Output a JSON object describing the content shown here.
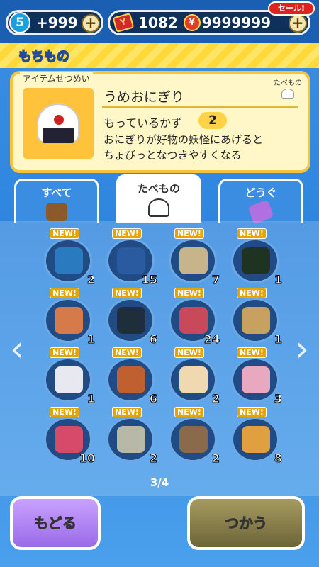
{
  "topbar": {
    "stamina_level": "5",
    "stamina_value": "+999",
    "plus_label": "+",
    "tickets": "1082",
    "money": "9999999",
    "sale_label": "セール!"
  },
  "section_title": "もちもの",
  "item_info": {
    "label": "アイテムせつめい",
    "name": "うめおにぎり",
    "category_tag": "たべもの",
    "count_label": "もっているかず",
    "count_value": "2",
    "description_line1": "おにぎりが好物の妖怪にあげると",
    "description_line2": "ちょびっとなつきやすくなる"
  },
  "tabs": [
    {
      "label": "すべて",
      "selected": false
    },
    {
      "label": "たべもの",
      "selected": true
    },
    {
      "label": "どうぐ",
      "selected": false
    }
  ],
  "grid": {
    "new_label": "NEW!",
    "items": [
      {
        "qty": "2",
        "color": "#2a7abf"
      },
      {
        "qty": "15",
        "color": "#2a5aa0"
      },
      {
        "qty": "7",
        "color": "#c8b48a"
      },
      {
        "qty": "1",
        "color": "#1e3322"
      },
      {
        "qty": "1",
        "color": "#d77a4a"
      },
      {
        "qty": "6",
        "color": "#1e2e3a"
      },
      {
        "qty": "24",
        "color": "#c84a5a"
      },
      {
        "qty": "1",
        "color": "#c8a060"
      },
      {
        "qty": "1",
        "color": "#e8e8f0"
      },
      {
        "qty": "6",
        "color": "#c06030"
      },
      {
        "qty": "2",
        "color": "#f0d8b0"
      },
      {
        "qty": "3",
        "color": "#e8a8c0"
      },
      {
        "qty": "10",
        "color": "#d84a6a"
      },
      {
        "qty": "2",
        "color": "#b8b8a8"
      },
      {
        "qty": "2",
        "color": "#8a6a4a"
      },
      {
        "qty": "8",
        "color": "#e0a040"
      }
    ]
  },
  "page_indicator": "3/4",
  "buttons": {
    "back_label": "もどる",
    "use_label": "つかう"
  },
  "nav": {
    "left": "‹",
    "right": "›"
  }
}
